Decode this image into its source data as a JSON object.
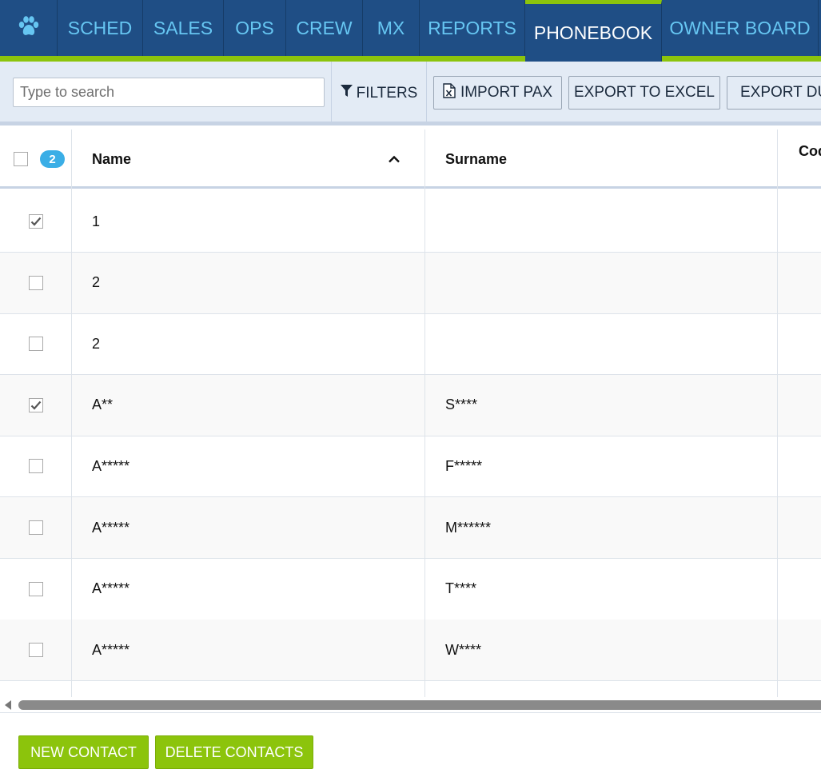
{
  "nav": {
    "logo_icon": "paw-icon",
    "tabs": [
      {
        "label": "SCHED"
      },
      {
        "label": "SALES"
      },
      {
        "label": "OPS"
      },
      {
        "label": "CREW"
      },
      {
        "label": "MX"
      },
      {
        "label": "REPORTS"
      },
      {
        "label": "PHONEBOOK",
        "active": true
      },
      {
        "label": "OWNER BOARD"
      }
    ]
  },
  "toolbar": {
    "search_placeholder": "Type to search",
    "filters_label": "FILTERS",
    "import_label": "IMPORT PAX",
    "export_excel_label": "EXPORT TO EXCEL",
    "export_dup_label": "EXPORT DUPLICATES"
  },
  "grid": {
    "selected_count": "2",
    "columns": {
      "name": "Name",
      "surname": "Surname",
      "code": "Code"
    },
    "rows": [
      {
        "checked": true,
        "name": "1",
        "surname": ""
      },
      {
        "checked": false,
        "name": "2",
        "surname": ""
      },
      {
        "checked": false,
        "name": "2",
        "surname": ""
      },
      {
        "checked": true,
        "name": "A**",
        "surname": "S****"
      },
      {
        "checked": false,
        "name": "A*****",
        "surname": "F*****"
      },
      {
        "checked": false,
        "name": "A*****",
        "surname": "M******"
      },
      {
        "checked": false,
        "name": "A*****",
        "surname": "T****"
      },
      {
        "checked": false,
        "name": "A*****",
        "surname": "W****"
      }
    ]
  },
  "footer": {
    "new_contact_label": "NEW CONTACT",
    "delete_contacts_label": "DELETE CONTACTS"
  },
  "colors": {
    "nav_bg": "#1f4e85",
    "accent_green": "#8cc40c",
    "nav_text": "#66c6f2",
    "badge_blue": "#3aaee6"
  }
}
